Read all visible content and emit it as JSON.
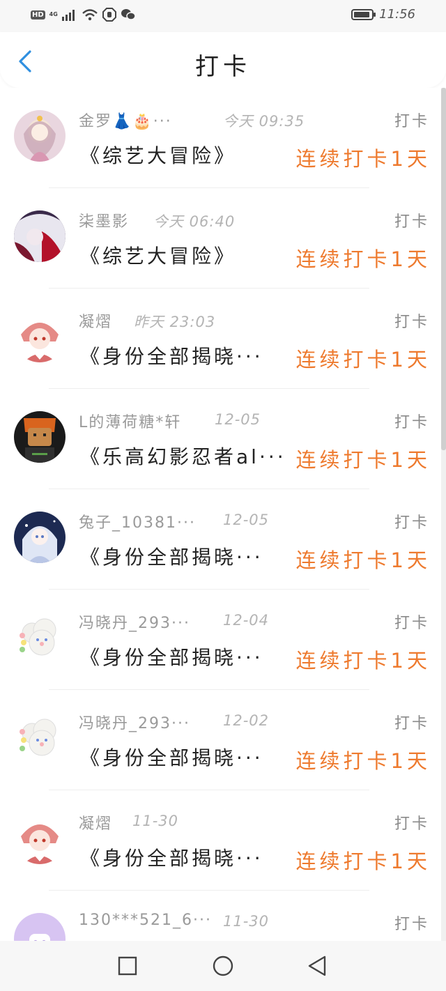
{
  "status_bar": {
    "network_badge": "HD",
    "network_type": "4G",
    "time": "11:56",
    "battery_level": 0.9,
    "icons": [
      "hd-icon",
      "signal-icon",
      "wifi-icon",
      "hand-icon",
      "wechat-icon",
      "battery-icon"
    ]
  },
  "header": {
    "title": "打卡",
    "back_icon": "chevron-left-icon",
    "accent_color": "#2f8fe0"
  },
  "colors": {
    "streak": "#ee7a2e",
    "name": "#9a9a9a",
    "time": "#b4b4b4"
  },
  "records": [
    {
      "name": "金罗👗🎂···",
      "time": "今天 09:35",
      "action": "打卡",
      "book": "《综艺大冒险》",
      "streak": "连续打卡1天",
      "avatar": "girl-princess-avatar"
    },
    {
      "name": "柒墨影",
      "time": "今天 06:40",
      "action": "打卡",
      "book": "《综艺大冒险》",
      "streak": "连续打卡1天",
      "avatar": "white-hair-avatar"
    },
    {
      "name": "凝熠",
      "time": "昨天 23:03",
      "action": "打卡",
      "book": "《身份全部揭晓···",
      "streak": "连续打卡1天",
      "avatar": "red-hair-boy-avatar"
    },
    {
      "name": "L的薄荷糖*轩",
      "time": "12-05",
      "action": "打卡",
      "book": "《乐高幻影忍者al···",
      "streak": "连续打卡1天",
      "avatar": "lego-ninja-avatar"
    },
    {
      "name": "兔子_10381···",
      "time": "12-05",
      "action": "打卡",
      "book": "《身份全部揭晓···",
      "streak": "连续打卡1天",
      "avatar": "anime-girl-blue-avatar"
    },
    {
      "name": "冯晓丹_293···",
      "time": "12-04",
      "action": "打卡",
      "book": "《身份全部揭晓···",
      "streak": "连续打卡1天",
      "avatar": "cloud-bunny-avatar"
    },
    {
      "name": "冯晓丹_293···",
      "time": "12-02",
      "action": "打卡",
      "book": "《身份全部揭晓···",
      "streak": "连续打卡1天",
      "avatar": "cloud-bunny-avatar"
    },
    {
      "name": "凝熠",
      "time": "11-30",
      "action": "打卡",
      "book": "《身份全部揭晓···",
      "streak": "连续打卡1天",
      "avatar": "red-hair-boy-avatar"
    },
    {
      "name": "130***521_6···",
      "time": "11-30",
      "action": "打卡",
      "book": "",
      "streak": "",
      "avatar": "purple-default-avatar"
    }
  ],
  "nav_bar": {
    "icons": [
      "recent-apps-icon",
      "home-icon",
      "back-triangle-icon"
    ]
  }
}
